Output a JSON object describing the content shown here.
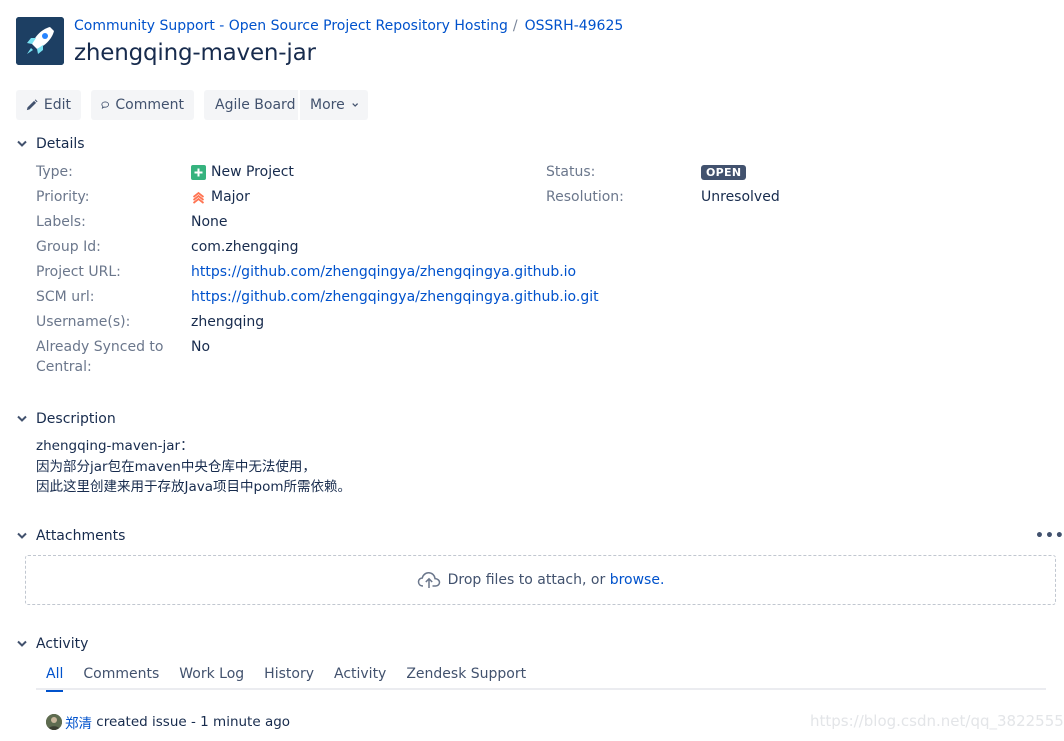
{
  "breadcrumb": {
    "project": "Community Support - Open Source Project Repository Hosting",
    "separator": "/",
    "issue_key": "OSSRH-49625"
  },
  "issue": {
    "title": "zhengqing-maven-jar"
  },
  "toolbar": {
    "edit": "Edit",
    "comment": "Comment",
    "agile_board": "Agile Board",
    "more": "More"
  },
  "details": {
    "heading": "Details",
    "type": {
      "label": "Type:",
      "value": "New Project",
      "icon": "new-project-icon",
      "color": "#36b37e"
    },
    "priority": {
      "label": "Priority:",
      "value": "Major",
      "icon": "priority-major-icon",
      "color": "#ff7452"
    },
    "labels": {
      "label": "Labels:",
      "value": "None"
    },
    "group_id": {
      "label": "Group Id:",
      "value": "com.zhengqing"
    },
    "project_url": {
      "label": "Project URL:",
      "value": "https://github.com/zhengqingya/zhengqingya.github.io"
    },
    "scm_url": {
      "label": "SCM url:",
      "value": "https://github.com/zhengqingya/zhengqingya.github.io.git"
    },
    "usernames": {
      "label": "Username(s):",
      "value": "zhengqing"
    },
    "synced": {
      "label_line1": "Already Synced to",
      "label_line2": "Central:",
      "value": "No"
    },
    "status": {
      "label": "Status:",
      "value": "OPEN",
      "color": "#42526e"
    },
    "resolution": {
      "label": "Resolution:",
      "value": "Unresolved"
    }
  },
  "description": {
    "heading": "Description",
    "line1": "zhengqing-maven-jar：",
    "line2": "因为部分jar包在maven中央仓库中无法使用，",
    "line3": "因此这里创建来用于存放Java项目中pom所需依赖。"
  },
  "attachments": {
    "heading": "Attachments",
    "more": "•••",
    "drop_text": "Drop files to attach, or",
    "browse": "browse."
  },
  "activity": {
    "heading": "Activity",
    "tabs": [
      "All",
      "Comments",
      "Work Log",
      "History",
      "Activity",
      "Zendesk Support"
    ],
    "entry": {
      "user": "郑清",
      "action": "created issue",
      "time": "- 1 minute ago"
    }
  },
  "watermark": "https://blog.csdn.net/qq_38225558",
  "colors": {
    "link": "#0052cc",
    "text": "#172b4d",
    "muted": "#6b778c",
    "button_bg": "#f4f5f7"
  }
}
